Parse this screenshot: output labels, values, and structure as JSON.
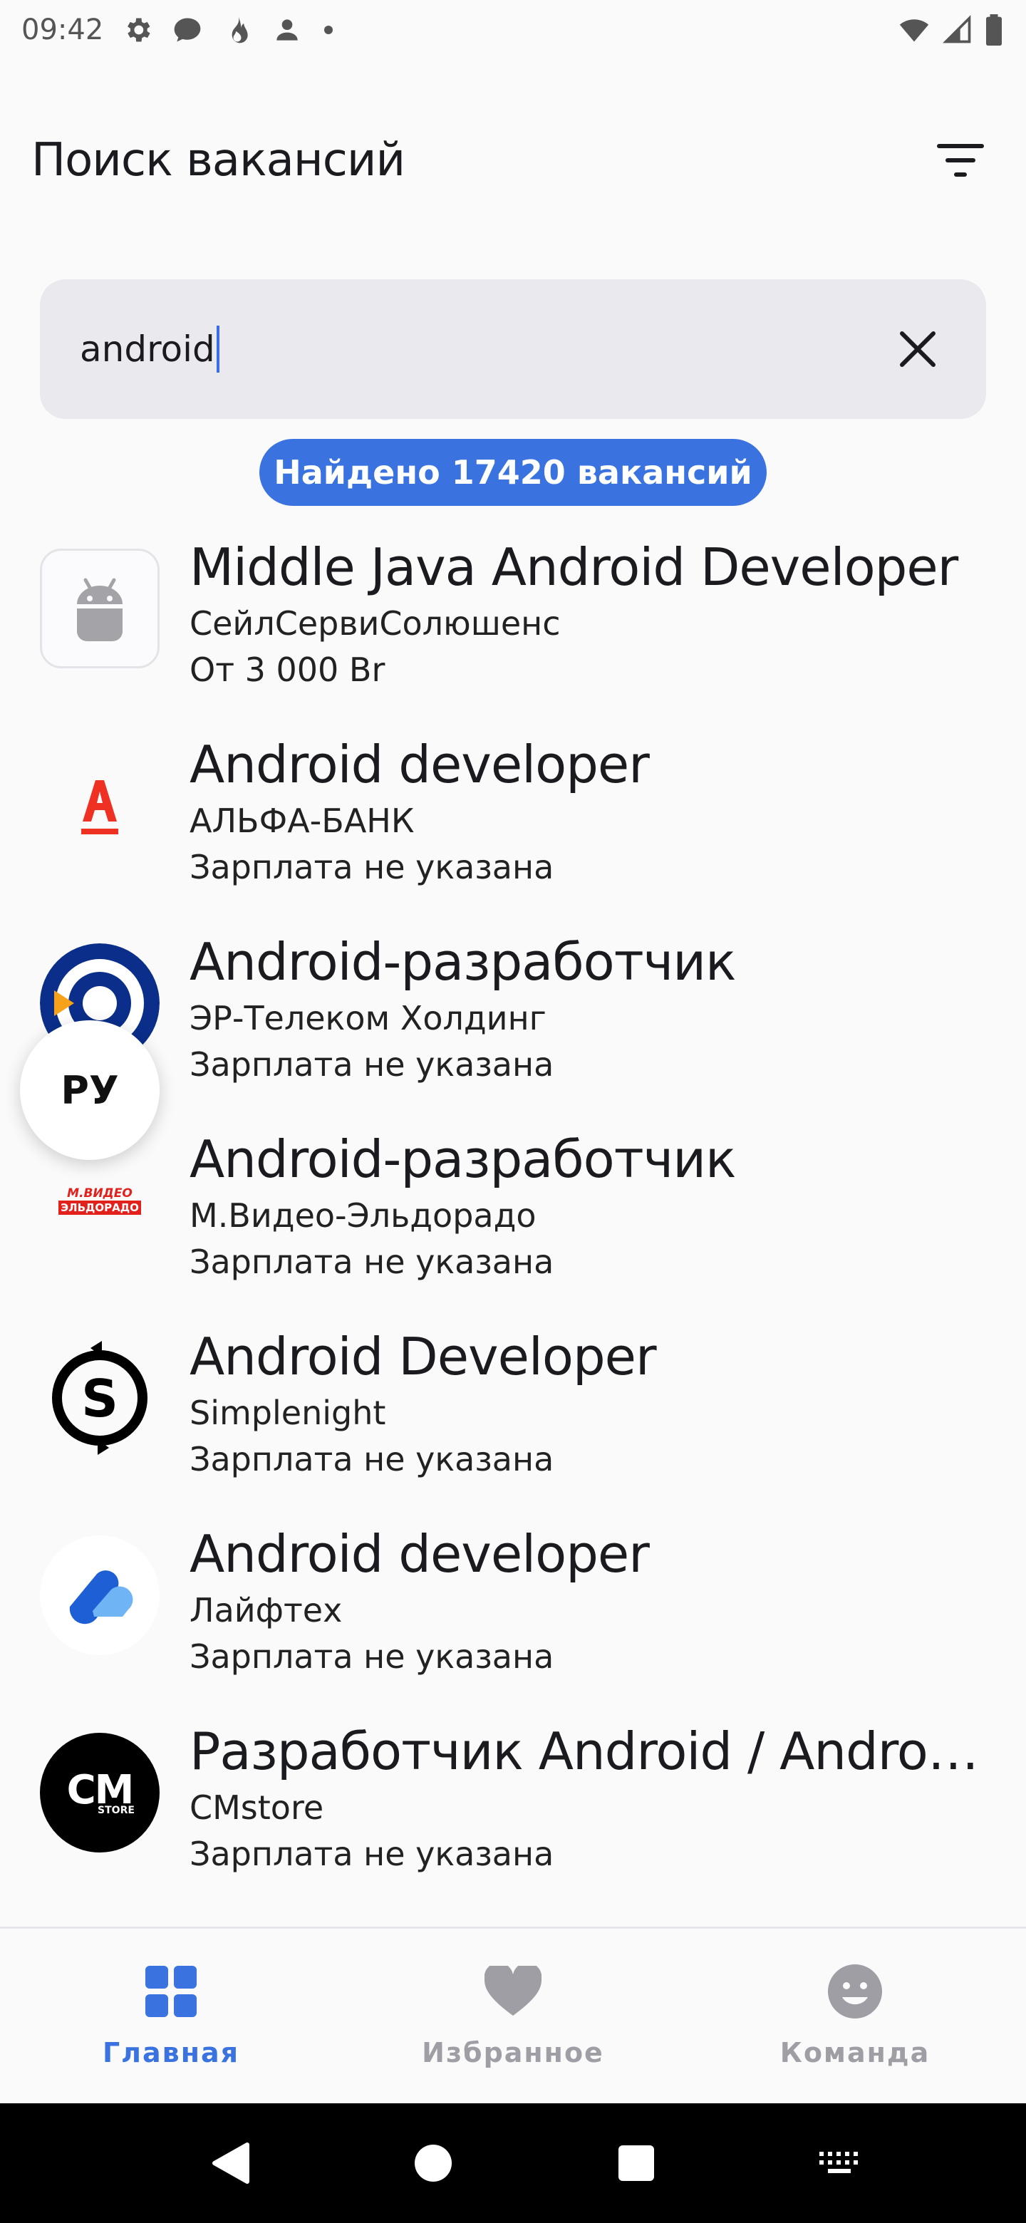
{
  "status_bar": {
    "time": "09:42",
    "icons": [
      "settings-icon",
      "chat-icon",
      "flame-icon",
      "person-icon",
      "dot-icon",
      "wifi-icon",
      "signal-icon",
      "battery-icon"
    ]
  },
  "header": {
    "title": "Поиск вакансий",
    "filter_icon": "filter-icon"
  },
  "search": {
    "value": "android",
    "clear_icon": "close-icon"
  },
  "results": {
    "label": "Найдено 17420 вакансий"
  },
  "vacancies": [
    {
      "title": "Middle Java Android Developer",
      "company": "СейлСервиСолюшенс",
      "salary": "От 3 000 Br",
      "logo": "android-logo"
    },
    {
      "title": "Android developer",
      "company": "АЛЬФА-БАНК",
      "salary": "Зарплата не указана",
      "logo": "alfa-bank-logo"
    },
    {
      "title": "Android-разработчик",
      "company": "ЭР-Телеком Холдинг",
      "salary": "Зарплата не указана",
      "logo": "er-telecom-logo"
    },
    {
      "title": "Android-разработчик",
      "company": "М.Видео-Эльдорадо",
      "salary": "Зарплата не указана",
      "logo": "mvideo-logo",
      "logo_text_1": "М.ВИДЕО",
      "logo_text_2": "ЭЛЬДОРАДО"
    },
    {
      "title": "Android Developer",
      "company": "Simplenight",
      "salary": "Зарплата не указана",
      "logo": "simplenight-logo"
    },
    {
      "title": "Android developer",
      "company": "Лайфтех",
      "salary": "Зарплата не указана",
      "logo": "lifetech-logo"
    },
    {
      "title": "Разработчик Android / Androi…",
      "company": "CMstore",
      "salary": "Зарплата не указана",
      "logo": "cmstore-logo",
      "logo_text_1": "CM",
      "logo_text_2": "STORE"
    }
  ],
  "fab": {
    "label": "РУ"
  },
  "bottom_nav": {
    "items": [
      {
        "label": "Главная",
        "icon": "grid-icon",
        "active": true
      },
      {
        "label": "Избранное",
        "icon": "heart-icon",
        "active": false
      },
      {
        "label": "Команда",
        "icon": "smile-icon",
        "active": false
      }
    ]
  },
  "colors": {
    "accent": "#3a73e0",
    "inactive": "#9e9ea4",
    "alfa_red": "#ef3124",
    "mvideo_red": "#e2211c"
  },
  "system_nav": {
    "icons": [
      "back-icon",
      "home-icon",
      "recents-icon",
      "keyboard-icon"
    ]
  }
}
